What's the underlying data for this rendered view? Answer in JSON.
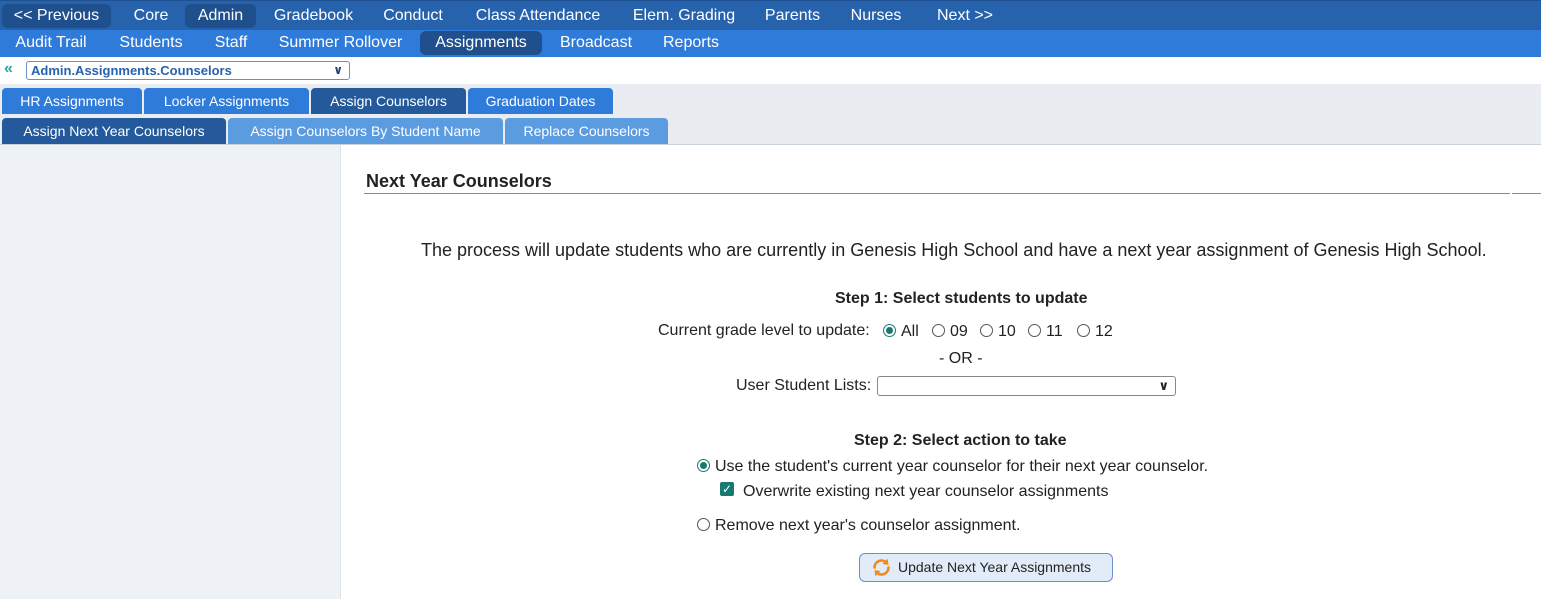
{
  "nav_primary": [
    {
      "label": "<< Previous"
    },
    {
      "label": "Core"
    },
    {
      "label": "Admin"
    },
    {
      "label": "Gradebook"
    },
    {
      "label": "Conduct"
    },
    {
      "label": "Class Attendance"
    },
    {
      "label": "Elem. Grading"
    },
    {
      "label": "Parents"
    },
    {
      "label": "Nurses"
    },
    {
      "label": "Next >>"
    }
  ],
  "nav_secondary": [
    {
      "label": "Audit Trail"
    },
    {
      "label": "Students"
    },
    {
      "label": "Staff"
    },
    {
      "label": "Summer Rollover"
    },
    {
      "label": "Assignments"
    },
    {
      "label": "Broadcast"
    },
    {
      "label": "Reports"
    }
  ],
  "breadcrumb": {
    "value": "Admin.Assignments.Counselors"
  },
  "tabs": [
    {
      "label": "HR Assignments"
    },
    {
      "label": "Locker Assignments"
    },
    {
      "label": "Assign Counselors"
    },
    {
      "label": "Graduation Dates"
    }
  ],
  "subtabs": [
    {
      "label": "Assign Next Year Counselors"
    },
    {
      "label": "Assign Counselors By Student Name"
    },
    {
      "label": "Replace Counselors"
    }
  ],
  "main": {
    "title": "Next Year Counselors",
    "description": "The process will update students who are currently in Genesis High School and have a next year assignment of Genesis High School.",
    "step1": {
      "heading": "Step 1: Select students to update",
      "grade_label": "Current grade level to update:",
      "grade_options": [
        {
          "label": "All",
          "selected": true
        },
        {
          "label": "09",
          "selected": false
        },
        {
          "label": "10",
          "selected": false
        },
        {
          "label": "11",
          "selected": false
        },
        {
          "label": "12",
          "selected": false
        }
      ],
      "or_text": "- OR -",
      "list_label": "User Student Lists:",
      "list_value": ""
    },
    "step2": {
      "heading": "Step 2: Select action to take",
      "option_use": "Use the student's current year counselor for their next year counselor.",
      "overwrite_label": "Overwrite existing next year counselor assignments",
      "option_remove": "Remove next year's counselor assignment."
    },
    "button_label": "Update Next Year Assignments"
  },
  "colors": {
    "nav_primary_bg": "#2762ad",
    "nav_secondary_bg": "#2f7bd9",
    "accent_teal": "#167a72",
    "refresh_orange": "#f08a1c"
  }
}
